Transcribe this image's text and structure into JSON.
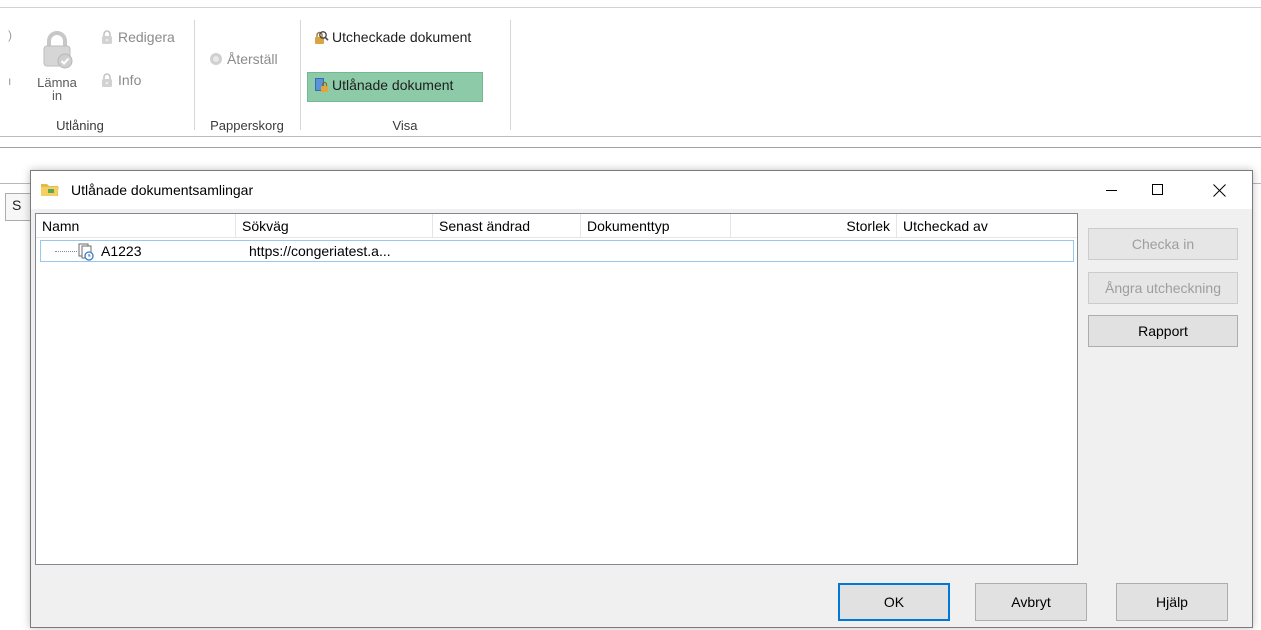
{
  "ribbon": {
    "groups": {
      "utlaning": {
        "label": "Utlåning",
        "lamna_in": "Lämna in",
        "redigera": "Redigera",
        "info": "Info"
      },
      "papperskorg": {
        "label": "Papperskorg",
        "aterstall": "Återställ"
      },
      "visa": {
        "label": "Visa",
        "utcheckade": "Utcheckade dokument",
        "utlanade": "Utlånade dokument"
      }
    },
    "active_highlight_color": "#8ccaa8"
  },
  "background_tab": {
    "label": "S"
  },
  "dialog": {
    "title": "Utlånade dokumentsamlingar",
    "columns": [
      "Namn",
      "Sökväg",
      "Senast ändrad",
      "Dokumenttyp",
      "Storlek",
      "Utcheckad av"
    ],
    "rows": [
      {
        "name": "A1223",
        "path": "https://congeriatest.a...",
        "modified": "",
        "doctype": "",
        "size": "",
        "checked_out_by": ""
      }
    ],
    "side_buttons": {
      "checka_in": "Checka in",
      "angra": "Ångra utcheckning",
      "rapport": "Rapport"
    },
    "bottom_buttons": {
      "ok": "OK",
      "avbryt": "Avbryt",
      "hjalp_first": "H",
      "hjalp_underlined": "j",
      "hjalp_rest": "älp"
    },
    "accent_color": "#0078d7"
  }
}
